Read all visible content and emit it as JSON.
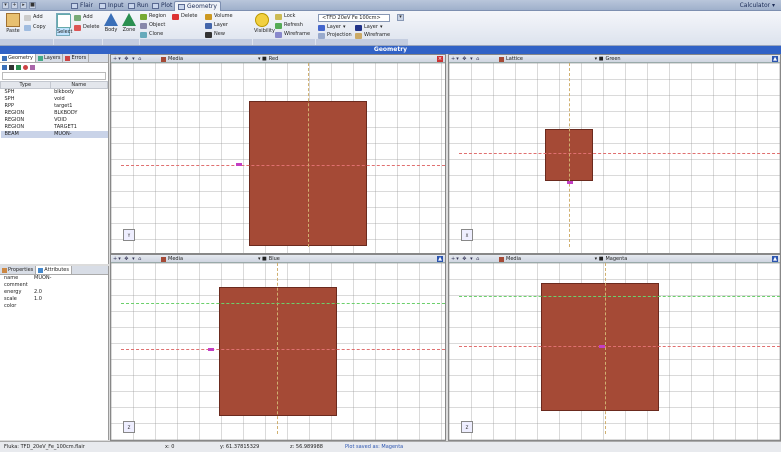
{
  "topbar": {
    "tabs": [
      {
        "label": "Flair",
        "icon": "flair-icon"
      },
      {
        "label": "Input",
        "icon": "input-icon"
      },
      {
        "label": "Run",
        "icon": "run-icon"
      },
      {
        "label": "Plot",
        "icon": "plot-icon"
      },
      {
        "label": "Geometry",
        "icon": "geometry-icon",
        "active": true
      }
    ],
    "right_label": "Calculator"
  },
  "ribbon": {
    "search_text": "<TFD 20eV Fe 100cm>",
    "buttons": {
      "add": "Add",
      "copy": "Copy",
      "paste": "Paste",
      "delete": "Delete",
      "select": "Select",
      "body": "Body",
      "zone": "Zone",
      "region": "Region",
      "object": "Object",
      "volume": "Volume",
      "lock": "Lock",
      "refresh": "Refresh",
      "layer": "Layer",
      "new": "New",
      "clone": "Clone",
      "visibility": "Visibility",
      "wireframe": "Wireframe",
      "projection": "Projection"
    }
  },
  "title": "Geometry",
  "left": {
    "tabs": [
      "Geometry",
      "Layers",
      "Errors"
    ],
    "columns": [
      "Type",
      "Name"
    ],
    "rows": [
      {
        "type": "SPH",
        "name": "blkbody"
      },
      {
        "type": "SPH",
        "name": "void"
      },
      {
        "type": "RPP",
        "name": "target1"
      },
      {
        "type": "REGION",
        "name": "BLKBODY"
      },
      {
        "type": "REGION",
        "name": "VOID"
      },
      {
        "type": "REGION",
        "name": "TARGET1"
      },
      {
        "type": "BEAM",
        "name": "MUON-",
        "selected": true
      }
    ],
    "bottom_tabs": [
      "Properties",
      "Attributes"
    ],
    "properties": [
      {
        "key": "name",
        "value": "MUON-"
      },
      {
        "key": "comment",
        "value": ""
      },
      {
        "key": "energy",
        "value": "2.0"
      },
      {
        "key": "scale",
        "value": "1.0"
      },
      {
        "key": "color",
        "value": ""
      }
    ]
  },
  "viewports": [
    {
      "id": "top-left",
      "name": "Media",
      "layer": "Red"
    },
    {
      "id": "top-right",
      "name": "Lattice",
      "layer": "Green"
    },
    {
      "id": "bottom-left",
      "name": "Media",
      "layer": "Blue"
    },
    {
      "id": "bottom-right",
      "name": "Media",
      "layer": "Magenta"
    }
  ],
  "status": {
    "file": "Fluka: TFD_20eV_Fe_100cm.flair",
    "x": "x: 0",
    "y": "y: 61.37815329",
    "z": "z: 56.989988",
    "message": "Plot saved as: Magenta"
  }
}
